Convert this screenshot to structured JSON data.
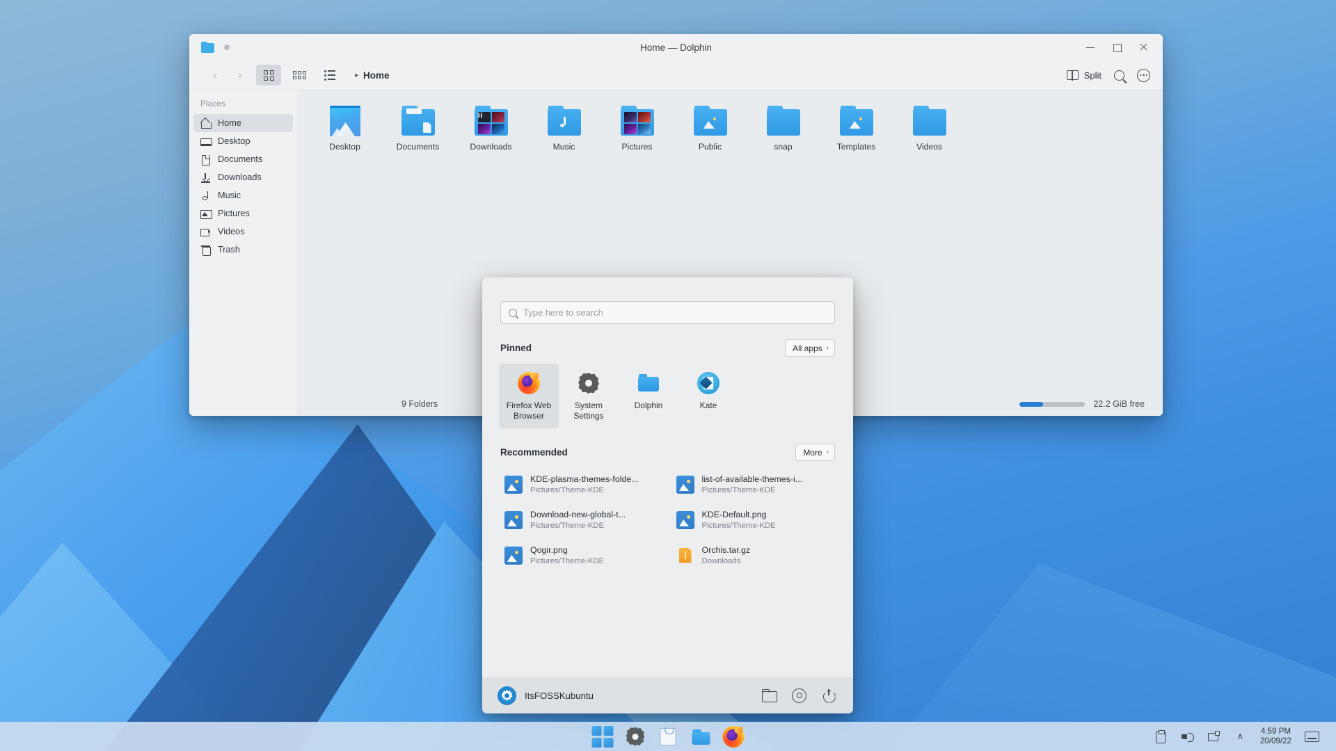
{
  "dolphin": {
    "title": "Home — Dolphin",
    "window_buttons": {
      "minimize": "minimize-button",
      "maximize": "maximize-button",
      "close": "close-button"
    },
    "toolbar": {
      "back": "‹",
      "forward": "›",
      "view_icons": "icons-view",
      "view_compact": "compact-view",
      "view_details": "details-view",
      "breadcrumb_arrow": "▸",
      "breadcrumb_home": "Home",
      "split_label": "Split"
    },
    "sidebar": {
      "header": "Places",
      "items": [
        {
          "label": "Home",
          "icon": "home-icon",
          "active": true
        },
        {
          "label": "Desktop",
          "icon": "desktop-icon",
          "active": false
        },
        {
          "label": "Documents",
          "icon": "documents-icon",
          "active": false
        },
        {
          "label": "Downloads",
          "icon": "downloads-icon",
          "active": false
        },
        {
          "label": "Music",
          "icon": "music-icon",
          "active": false
        },
        {
          "label": "Pictures",
          "icon": "pictures-icon",
          "active": false
        },
        {
          "label": "Videos",
          "icon": "videos-icon",
          "active": false
        },
        {
          "label": "Trash",
          "icon": "trash-icon",
          "active": false
        }
      ]
    },
    "folders": [
      {
        "label": "Desktop",
        "kind": "wallpaper-thumbnail"
      },
      {
        "label": "Documents",
        "kind": "folder-document"
      },
      {
        "label": "Downloads",
        "kind": "folder-thumbnails"
      },
      {
        "label": "Music",
        "kind": "folder-music"
      },
      {
        "label": "Pictures",
        "kind": "folder-thumbnails-pictures"
      },
      {
        "label": "Public",
        "kind": "folder-picture"
      },
      {
        "label": "snap",
        "kind": "folder-plain"
      },
      {
        "label": "Templates",
        "kind": "folder-picture"
      },
      {
        "label": "Videos",
        "kind": "folder-plain"
      }
    ],
    "status": {
      "count": "9 Folders",
      "free_space": "22.2 GiB free",
      "disk_used_percent": 36
    }
  },
  "kickoff": {
    "search": {
      "placeholder": "Type here to search",
      "value": ""
    },
    "pinned_section": {
      "title": "Pinned",
      "action_label": "All apps",
      "action_chevron": "›"
    },
    "pinned_apps": [
      {
        "label": "Firefox Web Browser",
        "icon": "firefox-icon",
        "selected": true
      },
      {
        "label": "System Settings",
        "icon": "gear-icon",
        "selected": false
      },
      {
        "label": "Dolphin",
        "icon": "folder-icon",
        "selected": false
      },
      {
        "label": "Kate",
        "icon": "kate-icon",
        "selected": false
      }
    ],
    "recommended_section": {
      "title": "Recommended",
      "action_label": "More",
      "action_chevron": "›"
    },
    "recommended": [
      {
        "name": "KDE-plasma-themes-folde...",
        "sub": "Pictures/Theme-KDE",
        "icon": "image-file-icon"
      },
      {
        "name": "list-of-available-themes-i...",
        "sub": "Pictures/Theme-KDE",
        "icon": "image-file-icon"
      },
      {
        "name": "Download-new-global-t...",
        "sub": "Pictures/Theme-KDE",
        "icon": "image-file-icon"
      },
      {
        "name": "KDE-Default.png",
        "sub": "Pictures/Theme-KDE",
        "icon": "image-file-icon"
      },
      {
        "name": "Qogir.png",
        "sub": "Pictures/Theme-KDE",
        "icon": "image-file-icon"
      },
      {
        "name": "Orchis.tar.gz",
        "sub": "Downloads",
        "icon": "archive-file-icon"
      }
    ],
    "footer": {
      "username": "ItsFOSSKubuntu",
      "buttons": [
        {
          "name": "files-button",
          "icon": "folder-icon"
        },
        {
          "name": "settings-button",
          "icon": "gear-icon"
        },
        {
          "name": "power-button",
          "icon": "power-icon"
        }
      ]
    }
  },
  "taskbar": {
    "launchers": [
      {
        "name": "kickoff-launcher",
        "icon": "kickoff-icon"
      },
      {
        "name": "system-settings",
        "icon": "gear-icon"
      },
      {
        "name": "discover",
        "icon": "shopping-bag-icon"
      },
      {
        "name": "dolphin",
        "icon": "folder-icon"
      },
      {
        "name": "firefox",
        "icon": "firefox-icon"
      }
    ],
    "tray": [
      {
        "name": "clipboard-icon"
      },
      {
        "name": "volume-icon"
      },
      {
        "name": "network-icon"
      },
      {
        "name": "chevron-up-icon",
        "glyph": "∧"
      }
    ],
    "clock": {
      "time": "4:59 PM",
      "date": "20/09/22"
    },
    "show_desktop": "show-desktop-icon"
  }
}
